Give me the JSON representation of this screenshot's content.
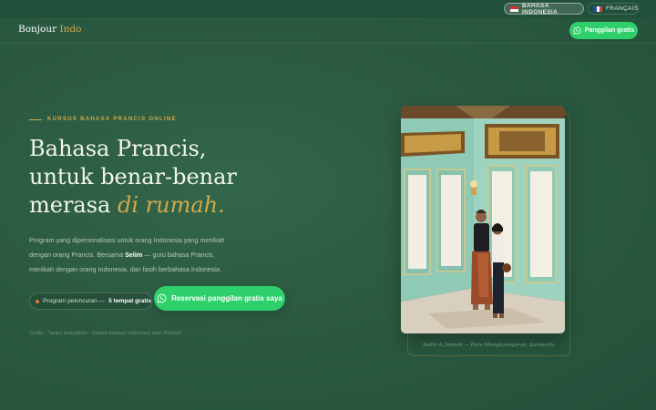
{
  "lang": {
    "indonesian": "BAHASA INDONESIA",
    "french": "FRANÇAIS"
  },
  "header": {
    "logo_main": "Bonjour",
    "logo_accent": "Indo",
    "cta_label": "Panggilan gratis"
  },
  "hero": {
    "eyebrow": "KURSUS BAHASA PRANCIS ONLINE",
    "headline_line1": "Bahasa Prancis,",
    "headline_line2": "untuk benar-benar",
    "headline_line3_plain": "merasa ",
    "headline_line3_italic": "di rumah.",
    "desc_part1": "Program yang dipersonalisasi untuk orang Indonesia yang menikah dengan orang Prancis. Bersama ",
    "desc_name": "Selim",
    "desc_part2": " — guru bahasa Prancis, menikah dengan orang Indonesia, dan fasih berbahasa Indonesia.",
    "launch_label": "Program peluncuran — ",
    "launch_bold": "5 tempat gratis",
    "cta_label": "Reservasi panggilan gratis saya",
    "trust": "Gratis · Tanpa kewajiban · Dalam bahasa Indonesia atau Prancis"
  },
  "photo": {
    "caption": "Selim & Jannah — Pura Mangkunegaran, Surakarta"
  },
  "colors": {
    "background": "#2b5a41",
    "accent_gold": "#d4a949",
    "whatsapp_green": "#2ed06b"
  },
  "icons": [
    "flag-id-icon",
    "flag-fr-icon",
    "whatsapp-icon",
    "dot-icon"
  ]
}
